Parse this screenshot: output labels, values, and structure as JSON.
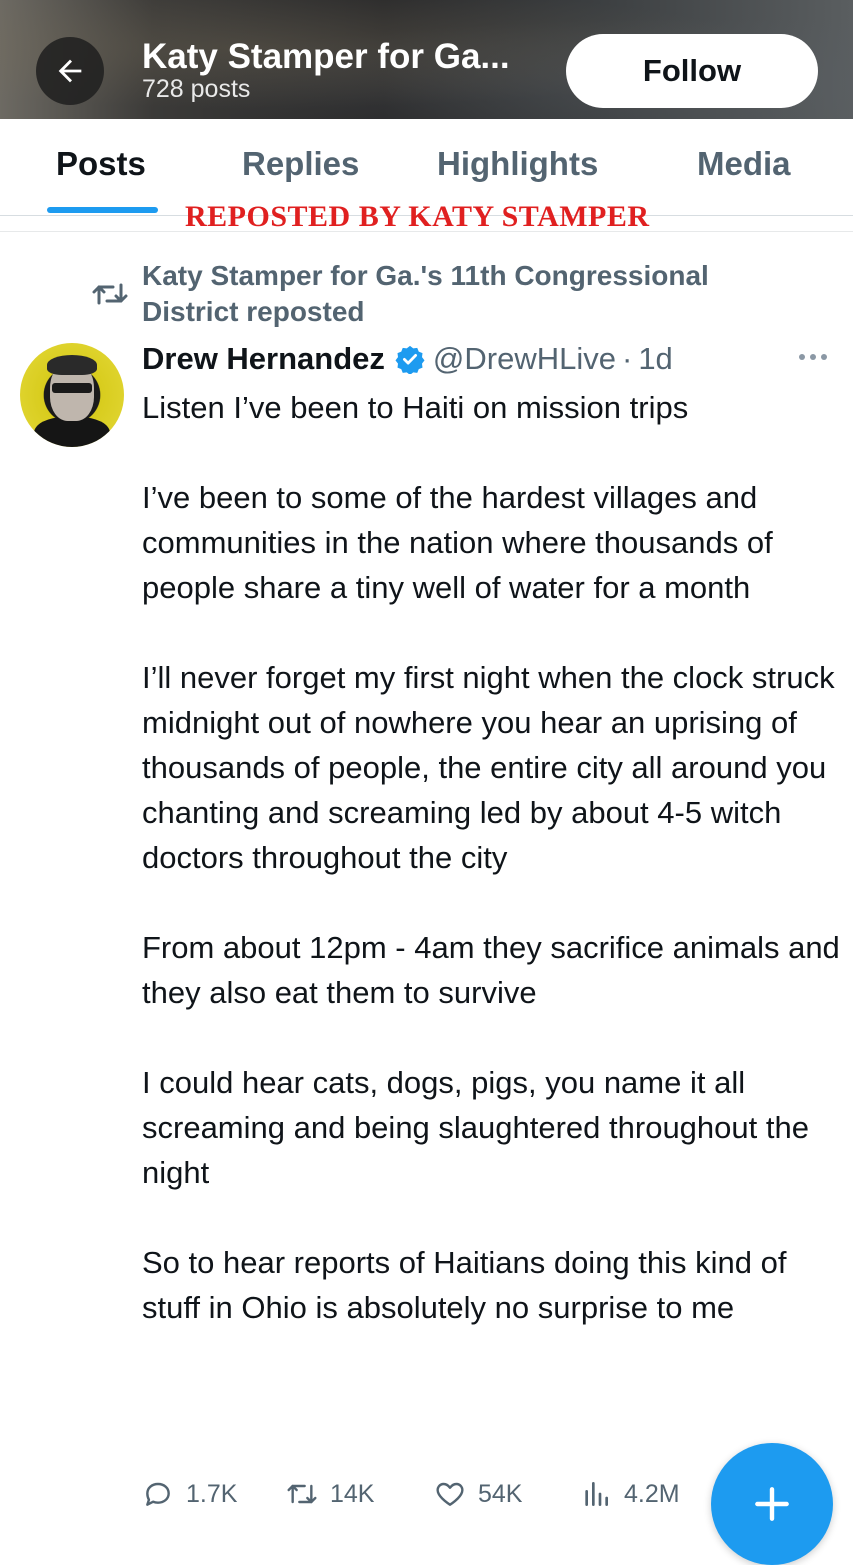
{
  "header": {
    "title": "Katy Stamper for Ga...",
    "posts_count": "728 posts",
    "follow_label": "Follow"
  },
  "tabs": [
    {
      "label": "Posts",
      "active": true
    },
    {
      "label": "Replies",
      "active": false
    },
    {
      "label": "Highlights",
      "active": false
    },
    {
      "label": "Media",
      "active": false
    }
  ],
  "overlay_banner": "REPOSTED BY KATY STAMPER",
  "colors": {
    "accent": "#1d9bf0",
    "banner": "#e02020",
    "secondary_text": "#536471"
  },
  "repost": {
    "text": "Katy Stamper for Ga.'s 11th Congressional District reposted",
    "icon": "repost-icon"
  },
  "post": {
    "display_name": "Drew Hernandez",
    "verified": true,
    "handle": "@DrewHLive",
    "separator": "·",
    "time": "1d",
    "paragraphs": [
      "Listen I’ve been to Haiti on mission trips",
      "I’ve been to some of the hardest villages and communities in the nation where thousands of people share a tiny well of water for a month",
      "I’ll never forget my first night when the clock struck midnight out of nowhere you hear an uprising of thousands of people, the entire city all around you chanting and screaming led by about 4-5 witch doctors throughout the city",
      "From about 12pm - 4am they sacrifice animals and they also eat them to survive",
      "I could hear cats, dogs, pigs, you name it all screaming and being slaughtered throughout the night",
      "So to hear reports of Haitians doing this kind of stuff in Ohio is absolutely no surprise to me"
    ],
    "stats": {
      "replies": "1.7K",
      "reposts": "14K",
      "likes": "54K",
      "views": "4.2M"
    }
  }
}
